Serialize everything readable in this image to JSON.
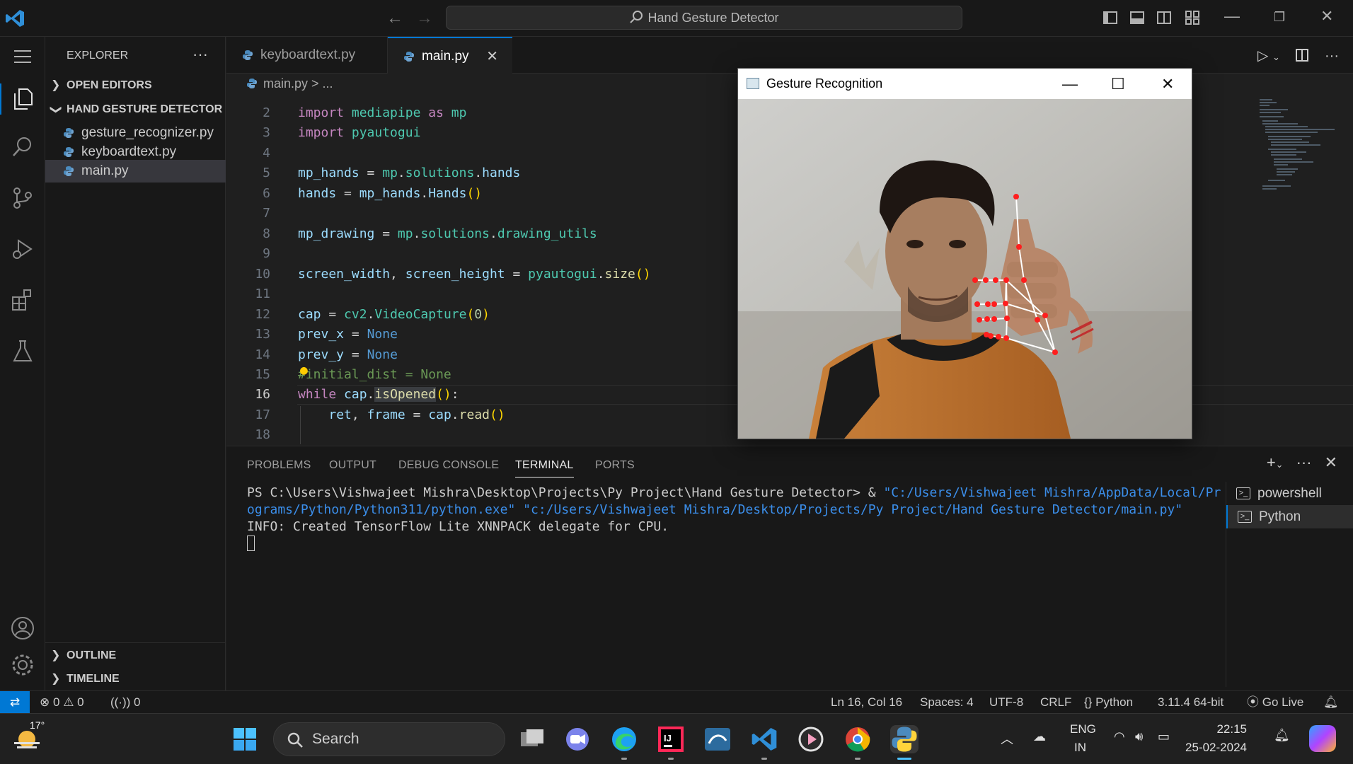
{
  "titlebar": {
    "search": "Hand Gesture Detector"
  },
  "activitybar": {
    "icons": [
      "menu-icon",
      "explorer-icon",
      "search-icon",
      "source-control-icon",
      "run-debug-icon",
      "extensions-icon",
      "testing-icon",
      "accounts-icon",
      "settings-gear-icon"
    ]
  },
  "sidebar": {
    "title": "EXPLORER",
    "more": "···",
    "open_editors": "OPEN EDITORS",
    "folder": "HAND GESTURE DETECTOR",
    "files": [
      "gesture_recognizer.py",
      "keyboardtext.py",
      "main.py"
    ],
    "outline": "OUTLINE",
    "timeline": "TIMELINE"
  },
  "tabs": {
    "tab1": "keyboardtext.py",
    "tab2": "main.py",
    "close": "✕"
  },
  "breadcrumb": {
    "file": "main.py",
    "rest": "> ..."
  },
  "editor": {
    "line_numbers": [
      "2",
      "3",
      "4",
      "5",
      "6",
      "7",
      "8",
      "9",
      "10",
      "11",
      "12",
      "13",
      "14",
      "15",
      "16",
      "17",
      "18"
    ],
    "current_line": "16"
  },
  "panel": {
    "tabs": [
      "PROBLEMS",
      "OUTPUT",
      "DEBUG CONSOLE",
      "TERMINAL",
      "PORTS"
    ],
    "active_tab": "TERMINAL",
    "terminal": {
      "prompt": "PS C:\\Users\\Vishwajeet Mishra\\Desktop\\Projects\\Py Project\\Hand Gesture Detector> & ",
      "arg1": "\"C:/Users/Vishwajeet Mishra/AppData/Local/Programs/Python/Python311/python.exe\"",
      "arg2": "\"c:/Users/Vishwajeet Mishra/Desktop/Projects/Py Project/Hand Gesture Detector/main.py\"",
      "info": "INFO: Created TensorFlow Lite XNNPACK delegate for CPU."
    },
    "terminals": [
      "powershell",
      "Python"
    ]
  },
  "statusbar": {
    "errors": "0",
    "warnings": "0",
    "ports": "0",
    "position": "Ln 16, Col 16",
    "spaces": "Spaces: 4",
    "encoding": "UTF-8",
    "eol": "CRLF",
    "language": "Python",
    "interpreter": "3.11.4 64-bit",
    "golive": "Go Live"
  },
  "gesture_window": {
    "title": "Gesture Recognition"
  },
  "taskbar": {
    "weather": "17°",
    "search": "Search",
    "lang1": "ENG",
    "lang2": "IN",
    "time": "22:15",
    "date": "25-02-2024"
  },
  "colors": {
    "accent": "#0078d4",
    "editor_bg": "#1f1f1f",
    "chrome_bg": "#181818"
  }
}
